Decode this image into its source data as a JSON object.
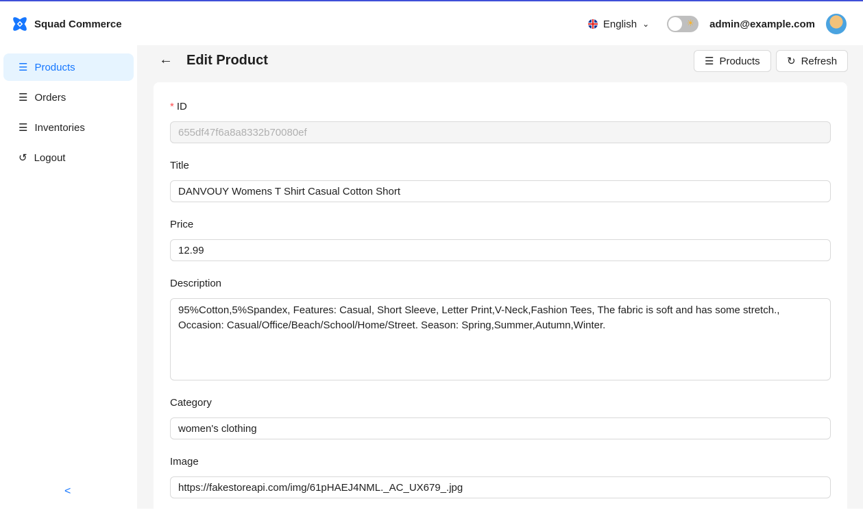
{
  "app": {
    "name": "Squad Commerce"
  },
  "header": {
    "language": "English",
    "user_email": "admin@example.com"
  },
  "sidebar": {
    "items": [
      {
        "label": "Products",
        "active": true
      },
      {
        "label": "Orders"
      },
      {
        "label": "Inventories"
      },
      {
        "label": "Logout"
      }
    ]
  },
  "page": {
    "title": "Edit Product",
    "products_button": "Products",
    "refresh_button": "Refresh"
  },
  "form": {
    "id": {
      "label": "ID",
      "required_mark": "*",
      "value": "655df47f6a8a8332b70080ef"
    },
    "title": {
      "label": "Title",
      "value": "DANVOUY Womens T Shirt Casual Cotton Short"
    },
    "price": {
      "label": "Price",
      "value": "12.99"
    },
    "description": {
      "label": "Description",
      "value": "95%Cotton,5%Spandex, Features: Casual, Short Sleeve, Letter Print,V-Neck,Fashion Tees, The fabric is soft and has some stretch., Occasion: Casual/Office/Beach/School/Home/Street. Season: Spring,Summer,Autumn,Winter."
    },
    "category": {
      "label": "Category",
      "value": "women's clothing"
    },
    "image": {
      "label": "Image",
      "value": "https://fakestoreapi.com/img/61pHAEJ4NML._AC_UX679_.jpg"
    }
  },
  "colors": {
    "primary": "#1677ff",
    "active_bg": "#e6f4ff",
    "topline": "#3f4fd8"
  }
}
